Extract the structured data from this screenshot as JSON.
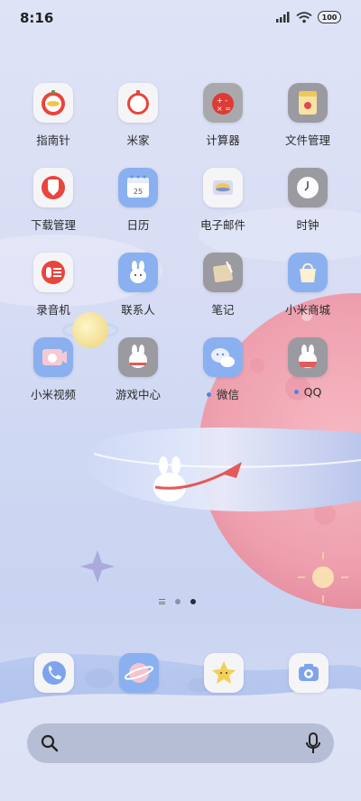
{
  "status_bar": {
    "time": "8:16",
    "battery": "100"
  },
  "apps": [
    {
      "label": "指南针",
      "icon": "compass-icon",
      "dot": false
    },
    {
      "label": "米家",
      "icon": "mijia-icon",
      "dot": false
    },
    {
      "label": "计算器",
      "icon": "calculator-icon",
      "dot": false
    },
    {
      "label": "文件管理",
      "icon": "file-manager-icon",
      "dot": false
    },
    {
      "label": "下载管理",
      "icon": "download-manager-icon",
      "dot": false
    },
    {
      "label": "日历",
      "icon": "calendar-icon",
      "dot": false,
      "badge": "25"
    },
    {
      "label": "电子邮件",
      "icon": "email-icon",
      "dot": false
    },
    {
      "label": "时钟",
      "icon": "clock-icon",
      "dot": false
    },
    {
      "label": "录音机",
      "icon": "recorder-icon",
      "dot": false
    },
    {
      "label": "联系人",
      "icon": "contacts-icon",
      "dot": false
    },
    {
      "label": "笔记",
      "icon": "notes-icon",
      "dot": false
    },
    {
      "label": "小米商城",
      "icon": "mi-store-icon",
      "dot": false
    },
    {
      "label": "小米视频",
      "icon": "mi-video-icon",
      "dot": false
    },
    {
      "label": "游戏中心",
      "icon": "game-center-icon",
      "dot": false
    },
    {
      "label": "微信",
      "icon": "wechat-icon",
      "dot": true
    },
    {
      "label": "QQ",
      "icon": "qq-icon",
      "dot": true
    }
  ],
  "dock": [
    {
      "name": "phone",
      "icon": "phone-icon"
    },
    {
      "name": "browser",
      "icon": "browser-icon"
    },
    {
      "name": "themes",
      "icon": "star-icon"
    },
    {
      "name": "camera",
      "icon": "camera-icon"
    }
  ],
  "page_indicator": {
    "pages": 2,
    "active": 2
  },
  "search": {
    "icon": "search-icon",
    "mic": "microphone-icon"
  },
  "colors": {
    "accent": "#4e84e6",
    "dock_bar": "#9aa2bb"
  }
}
